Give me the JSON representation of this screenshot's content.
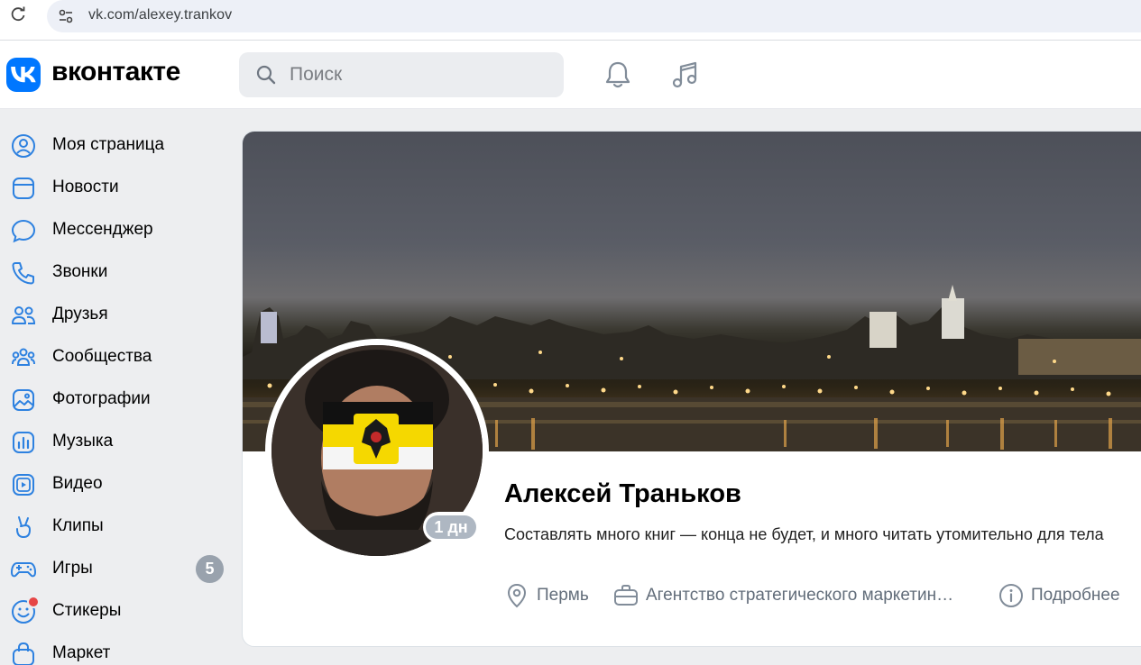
{
  "browser": {
    "url": "vk.com/alexey.trankov",
    "reload_icon": "reload-icon",
    "site_info_icon": "tune-icon"
  },
  "header": {
    "brand": "вконтакте",
    "search": {
      "placeholder": "Поиск",
      "value": ""
    },
    "icons": [
      "bell-icon",
      "music-note-icon"
    ]
  },
  "sidebar": {
    "items": [
      {
        "label": "Моя страница",
        "icon": "user-circle-icon"
      },
      {
        "label": "Новости",
        "icon": "news-icon"
      },
      {
        "label": "Мессенджер",
        "icon": "message-icon"
      },
      {
        "label": "Звонки",
        "icon": "phone-icon"
      },
      {
        "label": "Друзья",
        "icon": "friends-icon"
      },
      {
        "label": "Сообщества",
        "icon": "communities-icon"
      },
      {
        "label": "Фотографии",
        "icon": "photo-icon"
      },
      {
        "label": "Музыка",
        "icon": "music-icon"
      },
      {
        "label": "Видео",
        "icon": "video-icon"
      },
      {
        "label": "Клипы",
        "icon": "clips-icon"
      },
      {
        "label": "Игры",
        "icon": "gamepad-icon",
        "badge": "5"
      },
      {
        "label": "Стикеры",
        "icon": "sticker-icon",
        "dot": true
      },
      {
        "label": "Маркет",
        "icon": "market-bag-icon"
      }
    ]
  },
  "profile": {
    "name": "Алексей Траньков",
    "status": "Составлять много книг — конца не будет, и много читать утомительно для тела",
    "last_seen": "1 дн",
    "info": {
      "city": "Пермь",
      "work": "Агентство стратегического маркетин…",
      "more": "Подробнее"
    }
  },
  "colors": {
    "accent": "#0077ff",
    "icon": "#2d81e0",
    "page_bg": "#edeef0",
    "badge": "#99a2ad",
    "dot": "#e64646"
  }
}
